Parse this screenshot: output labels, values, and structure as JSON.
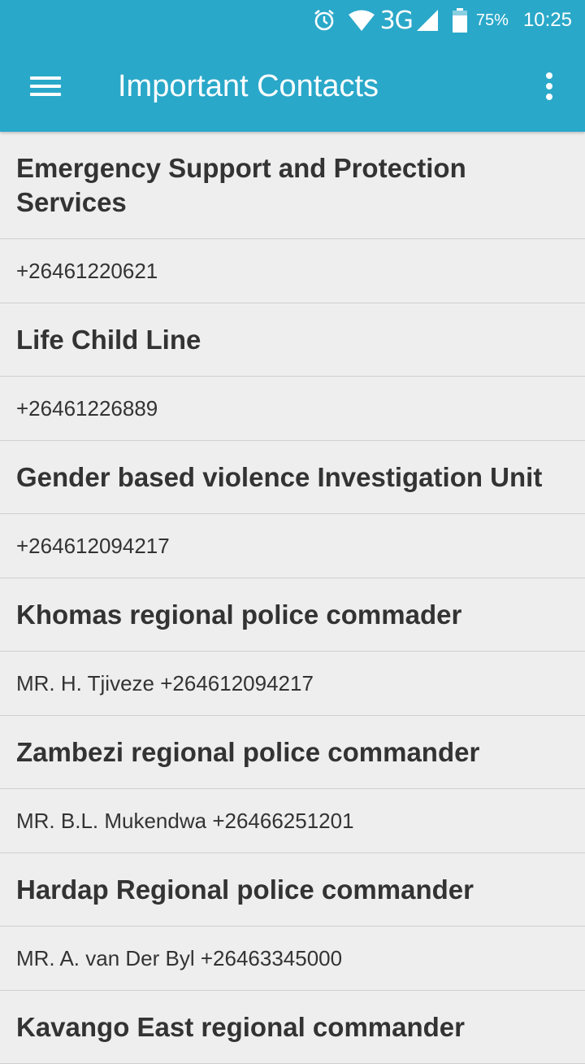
{
  "status_bar": {
    "network": "3G",
    "battery": "75%",
    "time": "10:25",
    "icons": [
      "alarm-icon",
      "wifi-icon",
      "signal-icon",
      "battery-icon"
    ]
  },
  "app_bar": {
    "title": "Important Contacts",
    "menu_icon": "hamburger-menu-icon",
    "overflow_icon": "more-vert-icon"
  },
  "contacts": [
    {
      "name": "Emergency Support and Protection Services",
      "detail": "+26461220621"
    },
    {
      "name": "Life Child Line",
      "detail": "+26461226889"
    },
    {
      "name": "Gender based violence Investigation Unit",
      "detail": "+264612094217"
    },
    {
      "name": "Khomas regional police commader",
      "detail": "MR. H. Tjiveze +264612094217"
    },
    {
      "name": "Zambezi regional police commander",
      "detail": "MR. B.L. Mukendwa +26466251201"
    },
    {
      "name": "Hardap Regional police commander",
      "detail": "MR. A. van Der Byl +26463345000"
    },
    {
      "name": "Kavango East regional commander",
      "detail": ""
    }
  ],
  "colors": {
    "primary": "#2aa8c9",
    "background": "#eeeeee",
    "text": "#333333",
    "divider": "#cfcfcf"
  }
}
